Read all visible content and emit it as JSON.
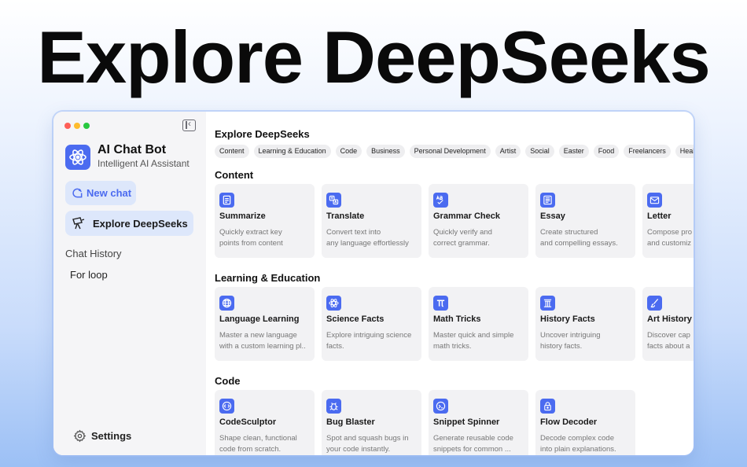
{
  "hero_title": "Explore DeepSeeks",
  "colors": {
    "accent": "#4b6bf0",
    "traffic_red": "#fe5f57",
    "traffic_yellow": "#febc2e",
    "traffic_green": "#28c840"
  },
  "sidebar": {
    "brand_title": "AI Chat Bot",
    "brand_subtitle": "Intelligent AI Assistant",
    "new_chat": "New chat",
    "explore": "Explore DeepSeeks",
    "history_title": "Chat History",
    "history_items": [
      "For loop"
    ],
    "settings": "Settings"
  },
  "main": {
    "title": "Explore DeepSeeks",
    "filters": [
      "Content",
      "Learning & Education",
      "Code",
      "Business",
      "Personal Development",
      "Artist",
      "Social",
      "Easter",
      "Food",
      "Freelancers",
      "Health"
    ],
    "sections": [
      {
        "title": "Content",
        "cards": [
          {
            "icon": "document-icon",
            "title": "Summarize",
            "desc": "Quickly extract key\npoints from content"
          },
          {
            "icon": "translate-icon",
            "title": "Translate",
            "desc": "Convert text into\nany language effortlessly"
          },
          {
            "icon": "grammar-icon",
            "title": "Grammar Check",
            "desc": "Quickly verify and\ncorrect grammar."
          },
          {
            "icon": "essay-icon",
            "title": "Essay",
            "desc": "Create structured\nand compelling essays."
          },
          {
            "icon": "letter-icon",
            "title": "Letter",
            "desc": "Compose pro\nand customiz"
          }
        ]
      },
      {
        "title": "Learning & Education",
        "cards": [
          {
            "icon": "globe-icon",
            "title": "Language Learning",
            "desc": "Master a new language\nwith a custom learning pl.."
          },
          {
            "icon": "atom-icon",
            "title": "Science Facts",
            "desc": "Explore intriguing science\nfacts."
          },
          {
            "icon": "pi-icon",
            "title": "Math Tricks",
            "desc": "Master quick and simple\nmath tricks."
          },
          {
            "icon": "column-icon",
            "title": "History Facts",
            "desc": "Uncover intriguing\nhistory facts."
          },
          {
            "icon": "brush-icon",
            "title": "Art History",
            "desc": "Discover cap\nfacts about a"
          }
        ]
      },
      {
        "title": "Code",
        "cards": [
          {
            "icon": "code-icon",
            "title": "CodeSculptor",
            "desc": "Shape clean, functional\ncode from scratch."
          },
          {
            "icon": "bug-icon",
            "title": "Bug Blaster",
            "desc": "Spot and squash bugs in\nyour code instantly."
          },
          {
            "icon": "snippet-icon",
            "title": "Snippet Spinner",
            "desc": "Generate reusable code\nsnippets for common ..."
          },
          {
            "icon": "lock-icon",
            "title": "Flow Decoder",
            "desc": "Decode complex code\ninto plain explanations."
          }
        ]
      }
    ]
  }
}
